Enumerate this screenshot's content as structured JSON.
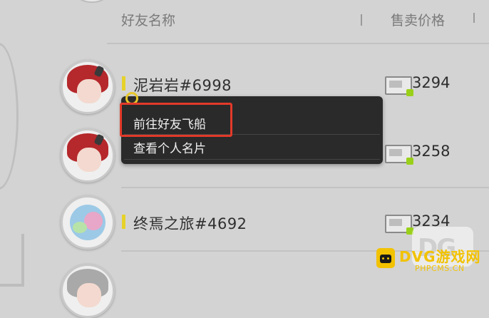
{
  "header": {
    "col_name": "好友名称",
    "col_price": "售卖价格"
  },
  "rows": [
    {
      "name": "泥岩岩#6998",
      "price": "3294",
      "avatar": "red-hair-avatar"
    },
    {
      "name": "",
      "price": "3258",
      "avatar": "red-hair-avatar"
    },
    {
      "name": "终焉之旅#4692",
      "price": "3234",
      "avatar": "pastel-avatar"
    }
  ],
  "context_menu": {
    "items": [
      "前往好友飞船",
      "查看个人名片"
    ]
  },
  "watermark": {
    "main": "DVG游戏网",
    "sub": "PHPCMS.CN"
  },
  "colors": {
    "background": "#d3d3d3",
    "menu_bg": "#2a2a2a",
    "highlight": "#e33a2a",
    "marker": "#e6d22a",
    "watermark": "#f2c200"
  }
}
